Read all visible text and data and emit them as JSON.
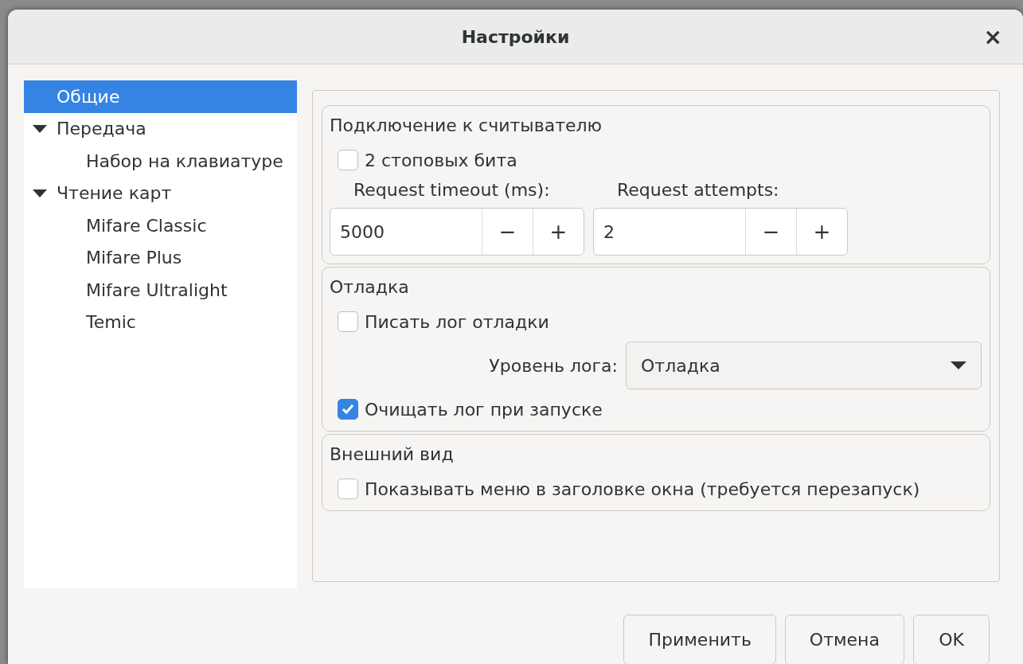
{
  "window": {
    "title": "Настройки",
    "close": "×"
  },
  "tree": [
    {
      "label": "Общие",
      "selected": true
    },
    {
      "label": "Передача",
      "selected": false,
      "expanded": true,
      "children": [
        {
          "label": "Набор на клавиатуре",
          "selected": false
        }
      ]
    },
    {
      "label": "Чтение карт",
      "selected": false,
      "expanded": true,
      "children": [
        {
          "label": "Mifare Classic",
          "selected": false
        },
        {
          "label": "Mifare Plus",
          "selected": false
        },
        {
          "label": "Mifare Ultralight",
          "selected": false
        },
        {
          "label": "Temic",
          "selected": false
        }
      ]
    }
  ],
  "sections": [
    {
      "title": "Подключение к считывателю",
      "items": [
        {
          "kind": "checkbox",
          "label": "2 стоповых бита",
          "checked": false
        },
        {
          "kind": "spinners",
          "fields": [
            {
              "label": "Request timeout (ms):",
              "value": "5000",
              "minus": "−",
              "plus": "+"
            },
            {
              "label": "Request attempts:",
              "value": "2",
              "minus": "−",
              "plus": "+"
            }
          ]
        }
      ]
    },
    {
      "title": "Отладка",
      "items": [
        {
          "kind": "checkbox",
          "label": "Писать лог отладки",
          "checked": false
        },
        {
          "kind": "combo",
          "label": "Уровень лога:",
          "value": "Отладка"
        },
        {
          "kind": "checkbox",
          "label": "Очищать лог при запуске",
          "checked": true
        }
      ]
    },
    {
      "title": "Внешний вид",
      "items": [
        {
          "kind": "checkbox",
          "label": "Показывать меню в заголовке окна (требуется перезапуск)",
          "checked": false
        }
      ]
    }
  ],
  "buttons": [
    {
      "label": "Применить"
    },
    {
      "label": "Отмена"
    },
    {
      "label": "OK"
    }
  ]
}
